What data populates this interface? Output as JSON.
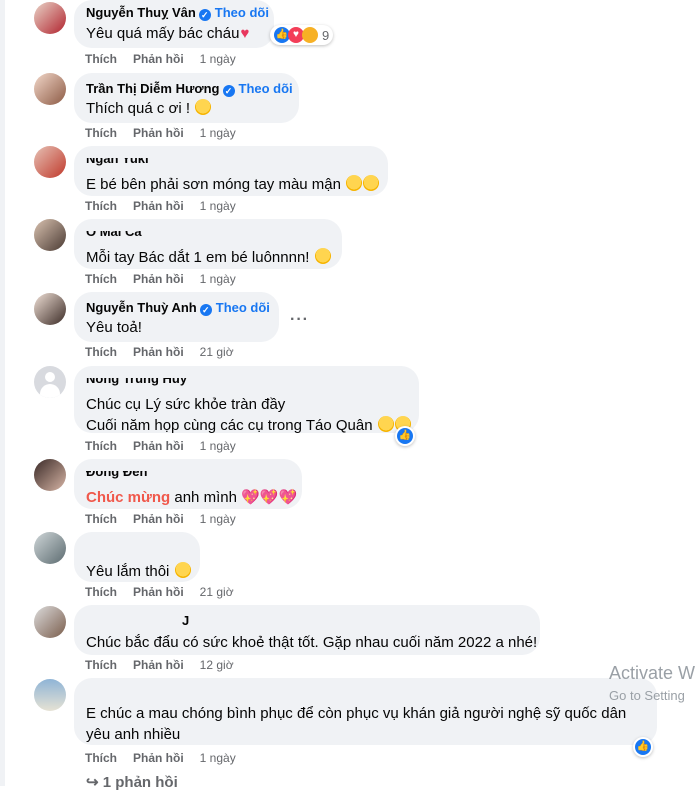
{
  "follow_label": "Theo dõi",
  "action_like": "Thích",
  "action_reply": "Phản hồi",
  "comments": [
    {
      "name": "Nguyễn Thuỵ Vân",
      "verified": true,
      "follow": true,
      "text": "Yêu quá mấy bác cháu",
      "time": "1 ngày",
      "reaction_count": "9"
    },
    {
      "name": "Trần Thị Diễm Hương",
      "verified": true,
      "follow": true,
      "text": "Thích quá c ơi !",
      "time": "1 ngày"
    },
    {
      "name": "Ngân Yuki",
      "text": "E bé bên phải sơn móng tay màu mận",
      "time": "1 ngày"
    },
    {
      "name": "Ô Mai Cà",
      "text": "Mỗi tay Bác dắt 1 em bé luônnnn!",
      "time": "1 ngày"
    },
    {
      "name": "Nguyễn Thuỳ Anh",
      "verified": true,
      "follow": true,
      "text": "Yêu toả!",
      "time": "21 giờ"
    },
    {
      "name": "Nông Trung Huy",
      "text_line1": "Chúc cụ Lý sức khỏe tràn đầy",
      "text_line2": "Cuối năm họp cùng các cụ trong Táo Quân",
      "time": "1 ngày"
    },
    {
      "name": "Đông Đen",
      "text_highlight": "Chúc mừng",
      "text": "anh mình",
      "time": "1 ngày"
    },
    {
      "name": "",
      "text": "Yêu lắm thôi",
      "time": "21 giờ"
    },
    {
      "name": "J",
      "text": "Chúc bắc đẩu có sức khoẻ thật tốt. Gặp nhau cuối năm 2022 a nhé!",
      "time": "12 giờ"
    },
    {
      "name": "",
      "text_line1": "E chúc a mau chóng bình phục để còn phục vụ khán giả người nghệ sỹ quốc dân",
      "text_line2": "yêu anh nhiều",
      "time": "1 ngày"
    }
  ],
  "more_replies": "1 phản hồi",
  "watermark": {
    "line1": "Activate W",
    "line2": "Go to Setting"
  }
}
